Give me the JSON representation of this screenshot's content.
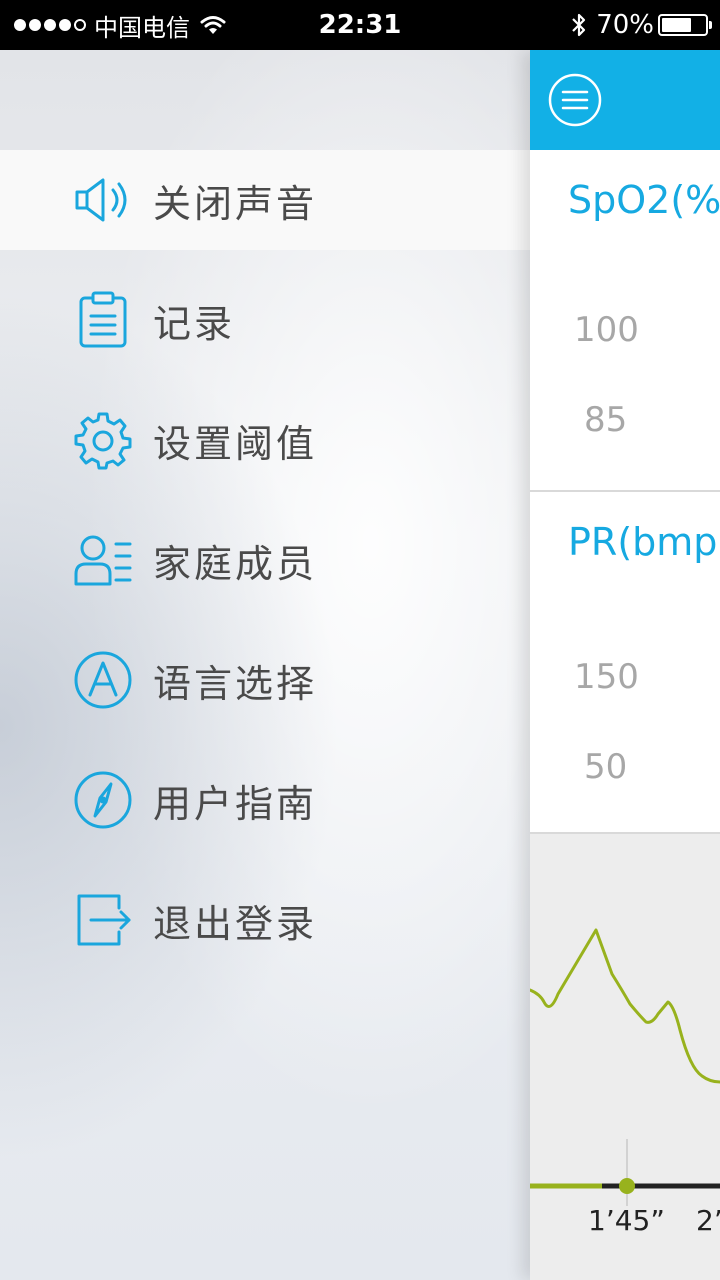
{
  "status_bar": {
    "carrier": "中国电信",
    "time": "22:31",
    "battery_percent_text": "70%",
    "battery_level": 0.7,
    "signal_dots": [
      true,
      true,
      true,
      true,
      false
    ]
  },
  "drawer": {
    "items": [
      {
        "label": "关闭声音",
        "icon": "speaker-icon",
        "active": true
      },
      {
        "label": "记录",
        "icon": "clipboard-icon",
        "active": false
      },
      {
        "label": "设置阈值",
        "icon": "gear-icon",
        "active": false
      },
      {
        "label": "家庭成员",
        "icon": "family-members-icon",
        "active": false
      },
      {
        "label": "语言选择",
        "icon": "language-icon",
        "active": false
      },
      {
        "label": "用户指南",
        "icon": "compass-icon",
        "active": false
      },
      {
        "label": "退出登录",
        "icon": "logout-icon",
        "active": false
      }
    ]
  },
  "main": {
    "spo2": {
      "title": "SpO2(%",
      "upper": "100",
      "lower": "85"
    },
    "pr": {
      "title": "PR(bmp",
      "upper": "150",
      "lower": "50"
    },
    "timeline": {
      "label_1": "1’45”",
      "label_2": "2’"
    }
  },
  "colors": {
    "accent": "#12b0e6",
    "icon": "#1aa6dd",
    "waveform": "#98b21d",
    "text": "#4a4a4a",
    "limit_text": "#a7a7a7"
  }
}
